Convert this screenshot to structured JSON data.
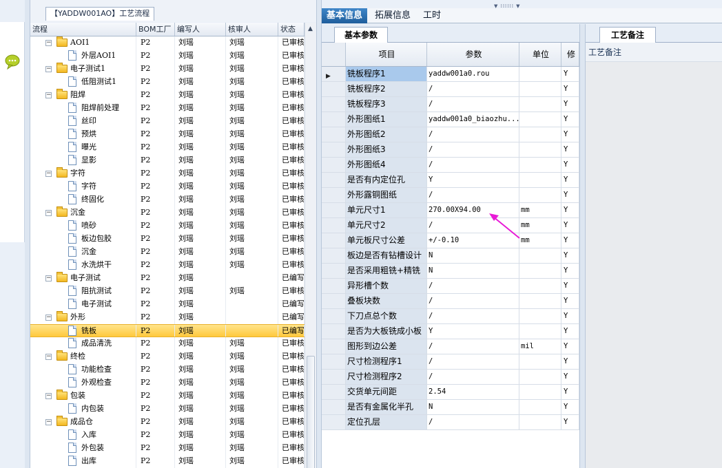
{
  "window": {
    "left_title": "【YADDW001AO】工艺流程",
    "colors": {
      "accent": "#2a6db2",
      "selected_row": "#ffd35a",
      "annotation_arrow": "#e81ad6"
    }
  },
  "tree": {
    "headers": {
      "name": "流程",
      "bom": "BOM工厂",
      "writer": "编写人",
      "reviewer": "核审人",
      "status": "状态"
    },
    "rows": [
      {
        "name": "AOI1",
        "type": "folder",
        "bom": "P2",
        "writer": "刘瑶",
        "reviewer": "刘瑶",
        "status": "已审核"
      },
      {
        "name": "外层AOI1",
        "type": "doc",
        "bom": "P2",
        "writer": "刘瑶",
        "reviewer": "刘瑶",
        "status": "已审核"
      },
      {
        "name": "电子测试1",
        "type": "folder",
        "bom": "P2",
        "writer": "刘瑶",
        "reviewer": "刘瑶",
        "status": "已审核"
      },
      {
        "name": "低阻测试1",
        "type": "doc",
        "bom": "P2",
        "writer": "刘瑶",
        "reviewer": "刘瑶",
        "status": "已审核"
      },
      {
        "name": "阻焊",
        "type": "folder",
        "bom": "P2",
        "writer": "刘瑶",
        "reviewer": "刘瑶",
        "status": "已审核"
      },
      {
        "name": "阻焊前处理",
        "type": "doc",
        "bom": "P2",
        "writer": "刘瑶",
        "reviewer": "刘瑶",
        "status": "已审核"
      },
      {
        "name": "丝印",
        "type": "doc",
        "bom": "P2",
        "writer": "刘瑶",
        "reviewer": "刘瑶",
        "status": "已审核"
      },
      {
        "name": "预烘",
        "type": "doc",
        "bom": "P2",
        "writer": "刘瑶",
        "reviewer": "刘瑶",
        "status": "已审核"
      },
      {
        "name": "曝光",
        "type": "doc",
        "bom": "P2",
        "writer": "刘瑶",
        "reviewer": "刘瑶",
        "status": "已审核"
      },
      {
        "name": "显影",
        "type": "doc",
        "bom": "P2",
        "writer": "刘瑶",
        "reviewer": "刘瑶",
        "status": "已审核"
      },
      {
        "name": "字符",
        "type": "folder",
        "bom": "P2",
        "writer": "刘瑶",
        "reviewer": "刘瑶",
        "status": "已审核"
      },
      {
        "name": "字符",
        "type": "doc",
        "bom": "P2",
        "writer": "刘瑶",
        "reviewer": "刘瑶",
        "status": "已审核"
      },
      {
        "name": "终固化",
        "type": "doc",
        "bom": "P2",
        "writer": "刘瑶",
        "reviewer": "刘瑶",
        "status": "已审核"
      },
      {
        "name": "沉金",
        "type": "folder",
        "bom": "P2",
        "writer": "刘瑶",
        "reviewer": "刘瑶",
        "status": "已审核"
      },
      {
        "name": "喷砂",
        "type": "doc",
        "bom": "P2",
        "writer": "刘瑶",
        "reviewer": "刘瑶",
        "status": "已审核"
      },
      {
        "name": "板边包胶",
        "type": "doc",
        "bom": "P2",
        "writer": "刘瑶",
        "reviewer": "刘瑶",
        "status": "已审核"
      },
      {
        "name": "沉金",
        "type": "doc",
        "bom": "P2",
        "writer": "刘瑶",
        "reviewer": "刘瑶",
        "status": "已审核"
      },
      {
        "name": "水洗烘干",
        "type": "doc",
        "bom": "P2",
        "writer": "刘瑶",
        "reviewer": "刘瑶",
        "status": "已审核"
      },
      {
        "name": "电子测试",
        "type": "folder",
        "bom": "P2",
        "writer": "刘瑶",
        "reviewer": "",
        "status": "已编写"
      },
      {
        "name": "阻抗测试",
        "type": "doc",
        "bom": "P2",
        "writer": "刘瑶",
        "reviewer": "刘瑶",
        "status": "已审核"
      },
      {
        "name": "电子测试",
        "type": "doc",
        "bom": "P2",
        "writer": "刘瑶",
        "reviewer": "",
        "status": "已编写"
      },
      {
        "name": "外形",
        "type": "folder",
        "bom": "P2",
        "writer": "刘瑶",
        "reviewer": "",
        "status": "已编写"
      },
      {
        "name": "铣板",
        "type": "doc",
        "bom": "P2",
        "writer": "刘瑶",
        "reviewer": "",
        "status": "已编写",
        "selected": true
      },
      {
        "name": "成品清洗",
        "type": "doc",
        "bom": "P2",
        "writer": "刘瑶",
        "reviewer": "刘瑶",
        "status": "已审核"
      },
      {
        "name": "终检",
        "type": "folder",
        "bom": "P2",
        "writer": "刘瑶",
        "reviewer": "刘瑶",
        "status": "已审核"
      },
      {
        "name": "功能检查",
        "type": "doc",
        "bom": "P2",
        "writer": "刘瑶",
        "reviewer": "刘瑶",
        "status": "已审核"
      },
      {
        "name": "外观检查",
        "type": "doc",
        "bom": "P2",
        "writer": "刘瑶",
        "reviewer": "刘瑶",
        "status": "已审核"
      },
      {
        "name": "包装",
        "type": "folder",
        "bom": "P2",
        "writer": "刘瑶",
        "reviewer": "刘瑶",
        "status": "已审核"
      },
      {
        "name": "内包装",
        "type": "doc",
        "bom": "P2",
        "writer": "刘瑶",
        "reviewer": "刘瑶",
        "status": "已审核"
      },
      {
        "name": "成品仓",
        "type": "folder",
        "bom": "P2",
        "writer": "刘瑶",
        "reviewer": "刘瑶",
        "status": "已审核"
      },
      {
        "name": "入库",
        "type": "doc",
        "bom": "P2",
        "writer": "刘瑶",
        "reviewer": "刘瑶",
        "status": "已审核"
      },
      {
        "name": "外包装",
        "type": "doc",
        "bom": "P2",
        "writer": "刘瑶",
        "reviewer": "刘瑶",
        "status": "已审核"
      },
      {
        "name": "出库",
        "type": "doc",
        "bom": "P2",
        "writer": "刘瑶",
        "reviewer": "刘瑶",
        "status": "已审核"
      }
    ]
  },
  "top_tabs": [
    "基本信息",
    "拓展信息",
    "工时"
  ],
  "sub_tab": "基本参数",
  "grid": {
    "headers": {
      "item": "项目",
      "param": "参数",
      "unit": "单位",
      "extra": "修"
    },
    "rows": [
      {
        "item": "铣板程序1",
        "param": "yaddw001a0.rou",
        "unit": "",
        "flag": "Y",
        "current": true
      },
      {
        "item": "铣板程序2",
        "param": "/",
        "unit": "",
        "flag": "Y"
      },
      {
        "item": "铣板程序3",
        "param": "/",
        "unit": "",
        "flag": "Y"
      },
      {
        "item": "外形图纸1",
        "param": "yaddw001a0_biaozhu...",
        "unit": "",
        "flag": "Y"
      },
      {
        "item": "外形图纸2",
        "param": "/",
        "unit": "",
        "flag": "Y"
      },
      {
        "item": "外形图纸3",
        "param": "/",
        "unit": "",
        "flag": "Y"
      },
      {
        "item": "外形图纸4",
        "param": "/",
        "unit": "",
        "flag": "Y"
      },
      {
        "item": "是否有内定位孔",
        "param": "Y",
        "unit": "",
        "flag": "Y"
      },
      {
        "item": "外形露铜图纸",
        "param": "/",
        "unit": "",
        "flag": "Y"
      },
      {
        "item": "单元尺寸1",
        "param": "270.00X94.00",
        "unit": "mm",
        "flag": "Y"
      },
      {
        "item": "单元尺寸2",
        "param": "/",
        "unit": "mm",
        "flag": "Y"
      },
      {
        "item": "单元板尺寸公差",
        "param": "+/-0.10",
        "unit": "mm",
        "flag": "Y"
      },
      {
        "item": "板边是否有钻槽设计",
        "param": "N",
        "unit": "",
        "flag": "Y"
      },
      {
        "item": "是否采用粗铣+精铣",
        "param": "N",
        "unit": "",
        "flag": "Y"
      },
      {
        "item": "异形槽个数",
        "param": "/",
        "unit": "",
        "flag": "Y"
      },
      {
        "item": "叠板块数",
        "param": "/",
        "unit": "",
        "flag": "Y"
      },
      {
        "item": "下刀点总个数",
        "param": "/",
        "unit": "",
        "flag": "Y"
      },
      {
        "item": "是否为大板铣成小板",
        "param": "Y",
        "unit": "",
        "flag": "Y"
      },
      {
        "item": "图形到边公差",
        "param": "/",
        "unit": "mil",
        "flag": "Y"
      },
      {
        "item": "尺寸检测程序1",
        "param": "/",
        "unit": "",
        "flag": "Y"
      },
      {
        "item": "尺寸检测程序2",
        "param": "/",
        "unit": "",
        "flag": "Y"
      },
      {
        "item": "交货单元间距",
        "param": "2.54",
        "unit": "",
        "flag": "Y"
      },
      {
        "item": "是否有金属化半孔",
        "param": "N",
        "unit": "",
        "flag": "Y"
      },
      {
        "item": "定位孔层",
        "param": "/",
        "unit": "",
        "flag": "Y"
      }
    ]
  },
  "remarks": {
    "tab": "工艺备注",
    "label": "工艺备注"
  }
}
